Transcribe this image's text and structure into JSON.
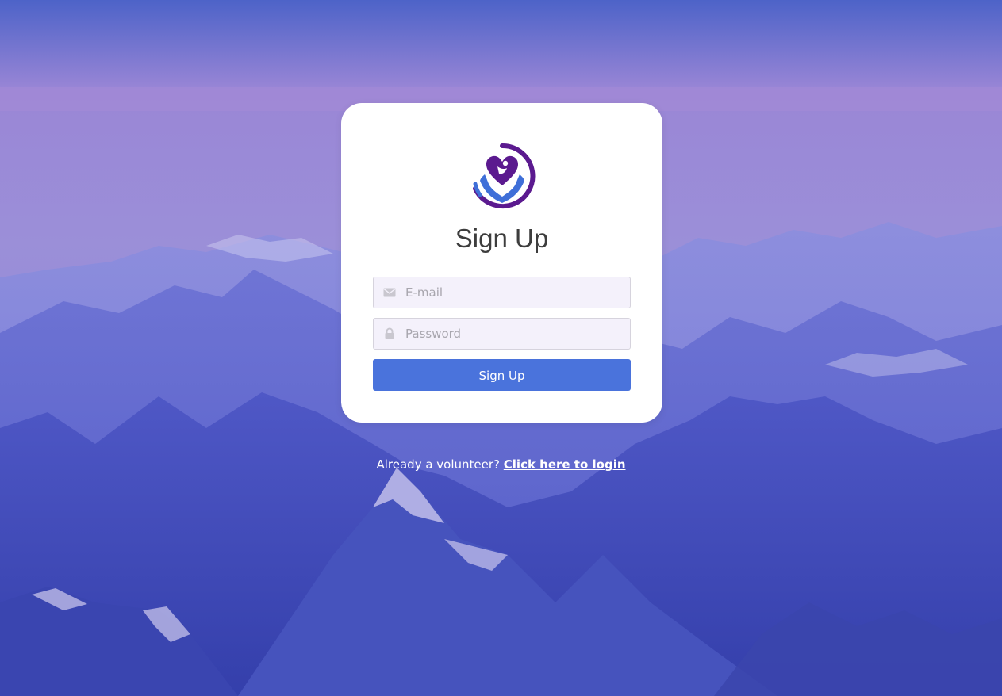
{
  "form": {
    "title": "Sign Up",
    "email_placeholder": "E-mail",
    "password_placeholder": "Password",
    "submit_label": "Sign Up",
    "email_icon": "envelope-icon",
    "password_icon": "lock-icon"
  },
  "footer": {
    "prompt_text": "Already a volunteer?",
    "login_link_text": "Click here to login"
  },
  "logo": {
    "icon": "heart-in-hands-icon"
  },
  "colors": {
    "accent": "#4a73dc",
    "logo_purple": "#5b1a8f",
    "logo_blue": "#3f6fd8",
    "input_bg": "#f4f1fb"
  }
}
